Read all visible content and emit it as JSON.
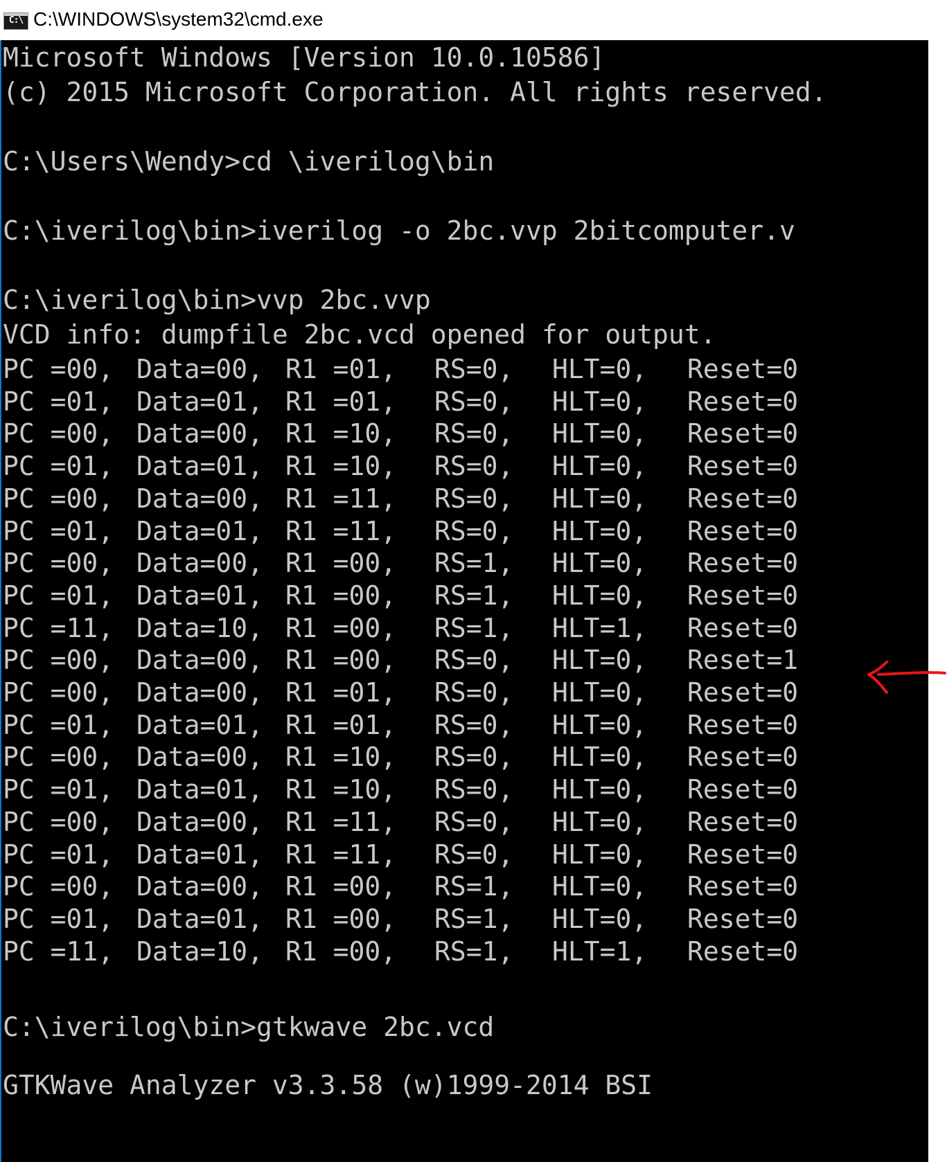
{
  "window": {
    "title": "C:\\WINDOWS\\system32\\cmd.exe",
    "icon_text": "C:\\"
  },
  "console": {
    "header": [
      "Microsoft Windows [Version 10.0.10586]",
      "(c) 2015 Microsoft Corporation. All rights reserved."
    ],
    "commands": [
      "C:\\Users\\Wendy>cd \\iverilog\\bin",
      "C:\\iverilog\\bin>iverilog -o 2bc.vvp 2bitcomputer.v",
      "C:\\iverilog\\bin>vvp 2bc.vvp",
      "C:\\iverilog\\bin>gtkwave 2bc.vcd"
    ],
    "vcd_info": "VCD info: dumpfile 2bc.vcd opened for output.",
    "gtkwave_banner": "GTKWave Analyzer v3.3.58 (w)1999-2014 BSI",
    "rows": [
      [
        "PC =00,",
        "Data=00,",
        "R1 =01,",
        "RS=0,",
        "HLT=0,",
        "Reset=0"
      ],
      [
        "PC =01,",
        "Data=01,",
        "R1 =01,",
        "RS=0,",
        "HLT=0,",
        "Reset=0"
      ],
      [
        "PC =00,",
        "Data=00,",
        "R1 =10,",
        "RS=0,",
        "HLT=0,",
        "Reset=0"
      ],
      [
        "PC =01,",
        "Data=01,",
        "R1 =10,",
        "RS=0,",
        "HLT=0,",
        "Reset=0"
      ],
      [
        "PC =00,",
        "Data=00,",
        "R1 =11,",
        "RS=0,",
        "HLT=0,",
        "Reset=0"
      ],
      [
        "PC =01,",
        "Data=01,",
        "R1 =11,",
        "RS=0,",
        "HLT=0,",
        "Reset=0"
      ],
      [
        "PC =00,",
        "Data=00,",
        "R1 =00,",
        "RS=1,",
        "HLT=0,",
        "Reset=0"
      ],
      [
        "PC =01,",
        "Data=01,",
        "R1 =00,",
        "RS=1,",
        "HLT=0,",
        "Reset=0"
      ],
      [
        "PC =11,",
        "Data=10,",
        "R1 =00,",
        "RS=1,",
        "HLT=1,",
        "Reset=0"
      ],
      [
        "PC =00,",
        "Data=00,",
        "R1 =00,",
        "RS=0,",
        "HLT=0,",
        "Reset=1"
      ],
      [
        "PC =00,",
        "Data=00,",
        "R1 =01,",
        "RS=0,",
        "HLT=0,",
        "Reset=0"
      ],
      [
        "PC =01,",
        "Data=01,",
        "R1 =01,",
        "RS=0,",
        "HLT=0,",
        "Reset=0"
      ],
      [
        "PC =00,",
        "Data=00,",
        "R1 =10,",
        "RS=0,",
        "HLT=0,",
        "Reset=0"
      ],
      [
        "PC =01,",
        "Data=01,",
        "R1 =10,",
        "RS=0,",
        "HLT=0,",
        "Reset=0"
      ],
      [
        "PC =00,",
        "Data=00,",
        "R1 =11,",
        "RS=0,",
        "HLT=0,",
        "Reset=0"
      ],
      [
        "PC =01,",
        "Data=01,",
        "R1 =11,",
        "RS=0,",
        "HLT=0,",
        "Reset=0"
      ],
      [
        "PC =00,",
        "Data=00,",
        "R1 =00,",
        "RS=1,",
        "HLT=0,",
        "Reset=0"
      ],
      [
        "PC =01,",
        "Data=01,",
        "R1 =00,",
        "RS=1,",
        "HLT=0,",
        "Reset=0"
      ],
      [
        "PC =11,",
        "Data=10,",
        "R1 =00,",
        "RS=1,",
        "HLT=1,",
        "Reset=0"
      ]
    ]
  },
  "annotation": {
    "icon": "red-arrow-icon",
    "color": "#e8141c"
  },
  "colors": {
    "console_bg": "#000000",
    "console_text": "#c8c8c8",
    "title_bg": "#ffffff",
    "window_border": "#0a78d7"
  }
}
